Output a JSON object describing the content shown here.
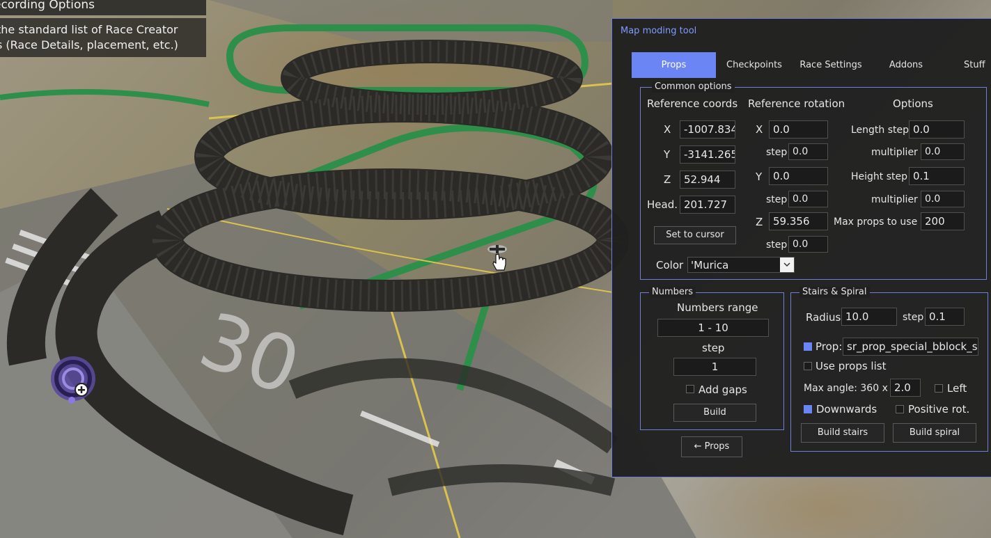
{
  "overlay": {
    "title": "ecording Options",
    "desc_line1": "the standard list of Race Creator",
    "desc_line2": "s (Race Details, placement, etc.)"
  },
  "window": {
    "title": "Map moding tool",
    "accent": "#6b86f4",
    "tabs": [
      "Props",
      "Checkpoints",
      "Race Settings",
      "Addons",
      "Stuff"
    ],
    "active_tab": "Props"
  },
  "common": {
    "legend": "Common options",
    "ref_coords_header": "Reference coords",
    "ref_rotation_header": "Reference rotation",
    "options_header": "Options",
    "coords": {
      "x_label": "X",
      "x": "-1007.834",
      "y_label": "Y",
      "y": "-3141.265",
      "z_label": "Z",
      "z": "52.944",
      "head_label": "Head.",
      "head": "201.727"
    },
    "set_to_cursor": "Set to cursor",
    "rotation": {
      "x_label": "X",
      "x": "0.0",
      "x_step_label": "step",
      "x_step": "0.0",
      "y_label": "Y",
      "y": "0.0",
      "y_step_label": "step",
      "y_step": "0.0",
      "z_label": "Z",
      "z": "59.356",
      "z_step_label": "step",
      "z_step": "0.0"
    },
    "options": {
      "length_step_label": "Length step",
      "length_step": "0.0",
      "length_mult_label": "multiplier",
      "length_mult": "0.0",
      "height_step_label": "Height step",
      "height_step": "0.1",
      "height_mult_label": "multiplier",
      "height_mult": "0.0",
      "max_props_label": "Max props to use",
      "max_props": "200"
    },
    "color_label": "Color",
    "color_value": "'Murica"
  },
  "numbers": {
    "legend": "Numbers",
    "range_label": "Numbers range",
    "range_value": "1  -  10",
    "step_label": "step",
    "step_value": "1",
    "add_gaps_label": "Add gaps",
    "add_gaps_checked": false,
    "build_label": "Build"
  },
  "stairs": {
    "legend": "Stairs & Spiral",
    "radius_label": "Radius",
    "radius": "10.0",
    "radius_step_label": "step",
    "radius_step": "0.1",
    "prop_label": "Prop:",
    "prop_checked": true,
    "prop_value": "sr_prop_special_bblock_sr",
    "use_props_list_label": "Use props list",
    "use_props_list_checked": false,
    "max_angle_label": "Max angle: 360 x",
    "max_angle": "2.0",
    "left_label": "Left",
    "left_checked": false,
    "downwards_label": "Downwards",
    "downwards_checked": true,
    "positive_rot_label": "Positive rot.",
    "positive_rot_checked": false,
    "build_stairs_label": "Build stairs",
    "build_spiral_label": "Build spiral"
  },
  "back_props_label": "← Props"
}
